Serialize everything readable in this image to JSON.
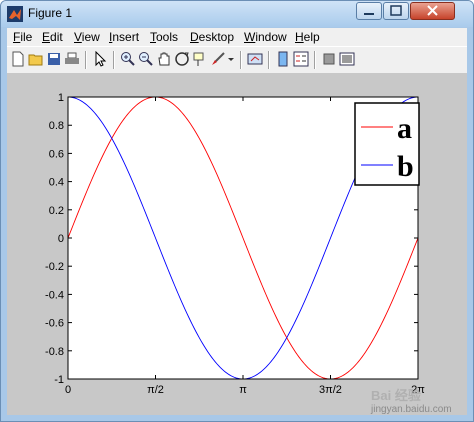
{
  "window": {
    "title": "Figure 1"
  },
  "menu": [
    "File",
    "Edit",
    "View",
    "Insert",
    "Tools",
    "Desktop",
    "Window",
    "Help"
  ],
  "toolbar": [
    "new-figure",
    "open-file",
    "save",
    "print",
    "edit-plot-arrow",
    "zoom-in",
    "zoom-out",
    "pan",
    "rotate-3d",
    "data-cursor",
    "brush",
    "link-plot",
    "insert-colorbar",
    "insert-legend",
    "hide-plot-tools",
    "show-plot-tools"
  ],
  "watermark": {
    "text": "Bai 经验",
    "sub": "jingyan.baidu.com"
  },
  "colors": {
    "series_a": "#ff0000",
    "series_b": "#0000ff",
    "figure_bg": "#c8c8c8",
    "axes_bg": "#ffffff"
  },
  "chart_data": {
    "type": "line",
    "x_range": [
      0,
      6.2832
    ],
    "ylim": [
      -1,
      1
    ],
    "x_tick_values": [
      0,
      1.5708,
      3.1416,
      4.7124,
      6.2832
    ],
    "x_tick_labels": [
      "0",
      "π/2",
      "π",
      "3π/2",
      "2π"
    ],
    "y_tick_values": [
      -1,
      -0.8,
      -0.6,
      -0.4,
      -0.2,
      0,
      0.2,
      0.4,
      0.6,
      0.8,
      1
    ],
    "y_tick_labels": [
      "-1",
      "-0.8",
      "-0.6",
      "-0.4",
      "-0.2",
      "0",
      "0.2",
      "0.4",
      "0.6",
      "0.8",
      "1"
    ],
    "legend_position": "top-right",
    "grid": false,
    "series": [
      {
        "name": "a",
        "color": "#ff0000",
        "function": "sin",
        "x": [
          0,
          0.7854,
          1.5708,
          2.3562,
          3.1416,
          3.927,
          4.7124,
          5.4978,
          6.2832
        ],
        "y": [
          0,
          0.7071,
          1,
          0.7071,
          0,
          -0.7071,
          -1,
          -0.7071,
          0
        ]
      },
      {
        "name": "b",
        "color": "#0000ff",
        "function": "cos",
        "x": [
          0,
          0.7854,
          1.5708,
          2.3562,
          3.1416,
          3.927,
          4.7124,
          5.4978,
          6.2832
        ],
        "y": [
          1,
          0.7071,
          0,
          -0.7071,
          -1,
          -0.7071,
          0,
          0.7071,
          1
        ]
      }
    ]
  }
}
